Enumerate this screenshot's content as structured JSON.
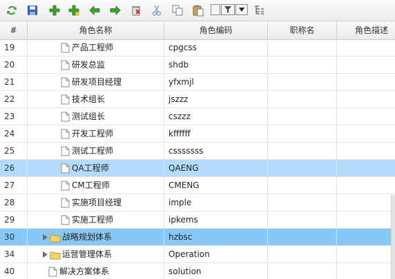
{
  "toolbar": {
    "buttons": [
      {
        "name": "refresh-icon"
      },
      {
        "name": "save-icon"
      },
      {
        "name": "add-icon"
      },
      {
        "name": "add-child-icon"
      },
      {
        "name": "arrow-left-icon"
      },
      {
        "name": "arrow-right-icon"
      },
      {
        "name": "delete-icon"
      },
      {
        "name": "cut-icon"
      },
      {
        "name": "copy-icon"
      },
      {
        "name": "paste-icon"
      },
      {
        "name": "filter-dropdown"
      },
      {
        "name": "tree-view-icon"
      }
    ]
  },
  "columns": {
    "num": "#",
    "name": "角色名称",
    "code": "角色编码",
    "title": "职称名",
    "desc": "角色描述"
  },
  "rows": [
    {
      "num": "19",
      "name": "产品工程师",
      "code": "cpgcss",
      "level": 2,
      "type": "leaf",
      "selected": ""
    },
    {
      "num": "20",
      "name": "研发总监",
      "code": "shdb",
      "level": 2,
      "type": "leaf",
      "selected": ""
    },
    {
      "num": "21",
      "name": "研发项目经理",
      "code": "yfxmjl",
      "level": 2,
      "type": "leaf",
      "selected": ""
    },
    {
      "num": "22",
      "name": "技术组长",
      "code": "jszzz",
      "level": 2,
      "type": "leaf",
      "selected": ""
    },
    {
      "num": "23",
      "name": "测试组长",
      "code": "cszzz",
      "level": 2,
      "type": "leaf",
      "selected": ""
    },
    {
      "num": "24",
      "name": "开发工程师",
      "code": "kffffff",
      "level": 2,
      "type": "leaf",
      "selected": ""
    },
    {
      "num": "25",
      "name": "测试工程师",
      "code": "csssssss",
      "level": 2,
      "type": "leaf",
      "selected": ""
    },
    {
      "num": "26",
      "name": "QA工程师",
      "code": "QAENG",
      "level": 2,
      "type": "leaf",
      "selected": "sel"
    },
    {
      "num": "27",
      "name": "CM工程师",
      "code": "CMENG",
      "level": 2,
      "type": "leaf",
      "selected": ""
    },
    {
      "num": "28",
      "name": "实施项目经理",
      "code": "imple",
      "level": 2,
      "type": "leaf",
      "selected": ""
    },
    {
      "num": "29",
      "name": "实施工程师",
      "code": "ipkems",
      "level": 2,
      "type": "leaf",
      "selected": ""
    },
    {
      "num": "30",
      "name": "战略规划体系",
      "code": "hzbsc",
      "level": 1,
      "type": "folder",
      "selected": "sel2"
    },
    {
      "num": "34",
      "name": "运营管理体系",
      "code": "Operation",
      "level": 1,
      "type": "folder",
      "selected": ""
    },
    {
      "num": "40",
      "name": "解决方案体系",
      "code": "solution",
      "level": 1,
      "type": "leaf",
      "selected": ""
    }
  ],
  "colors": {
    "selected_light": "#b3dcfb",
    "selected_strong": "#86c8f6"
  }
}
